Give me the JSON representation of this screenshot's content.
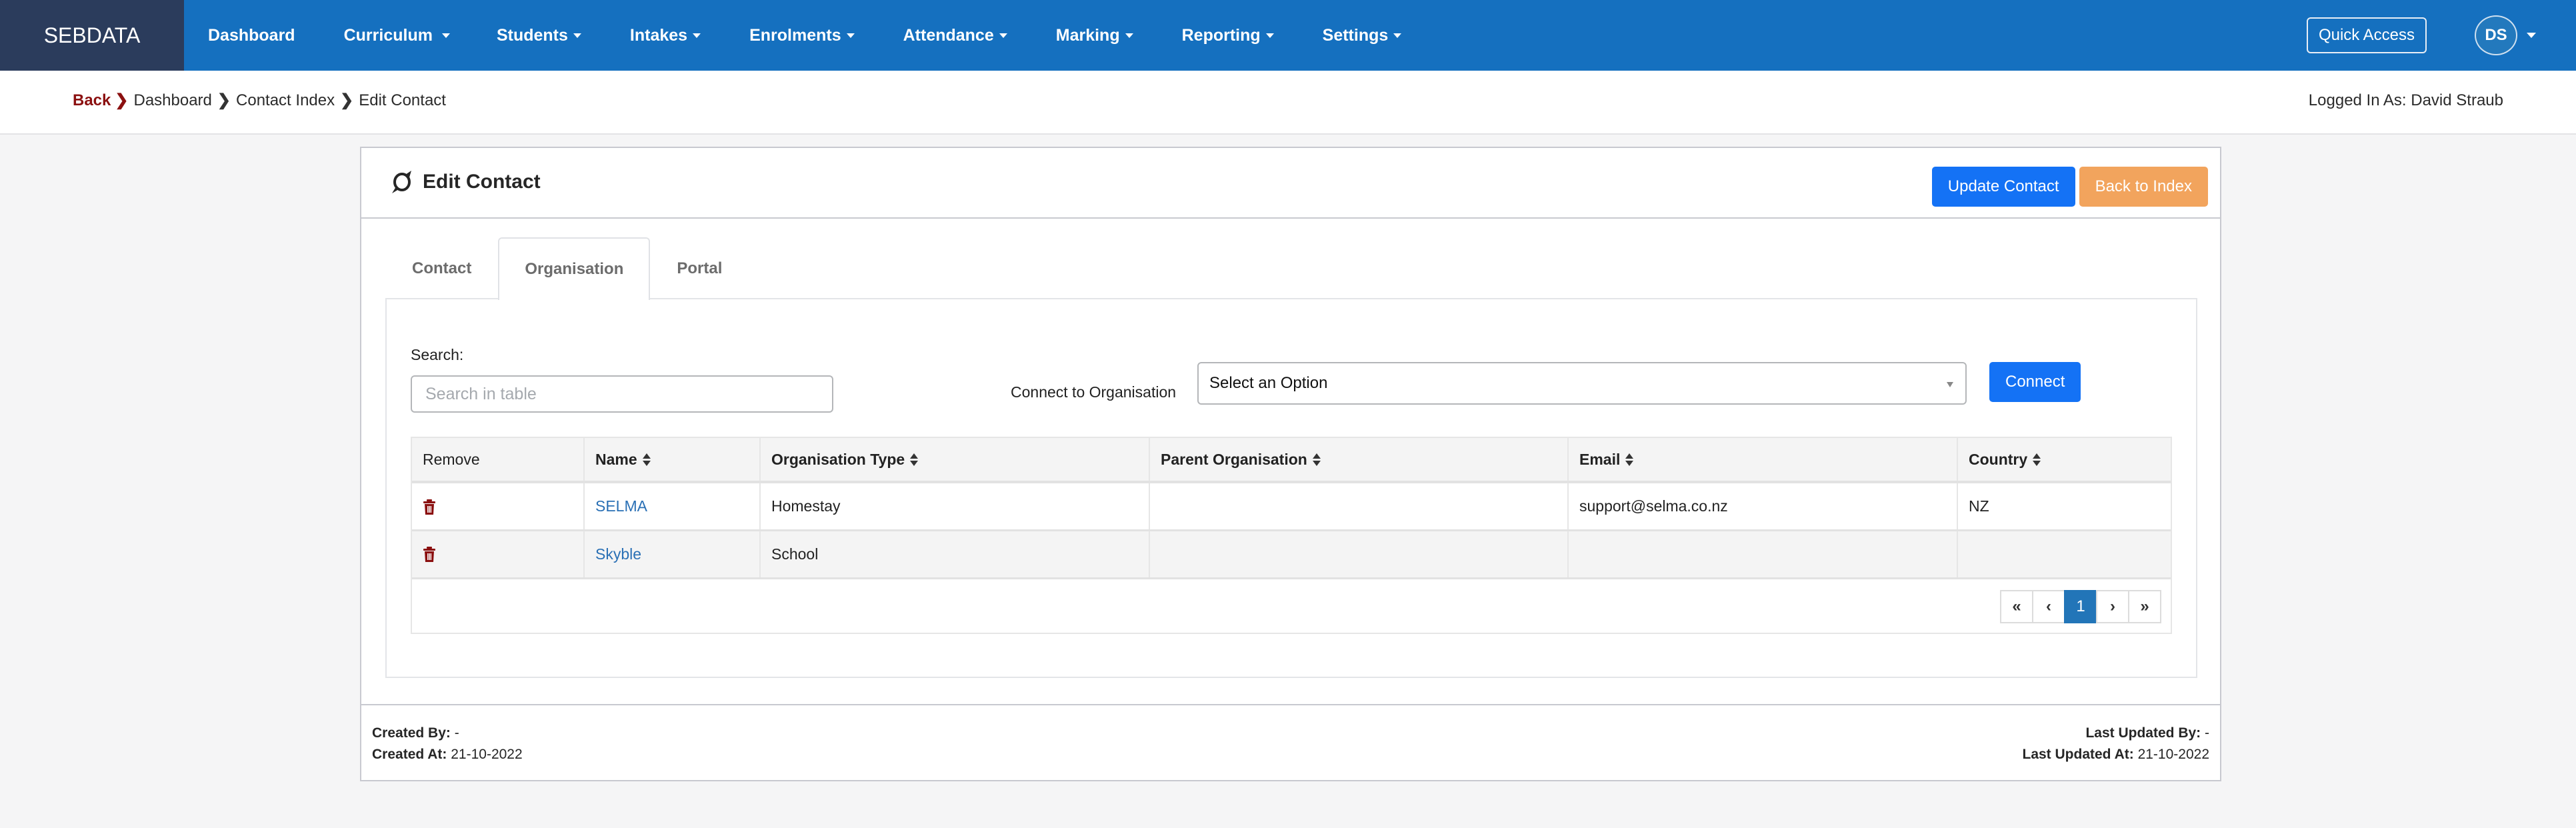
{
  "navbar": {
    "brand": "SEBDATA",
    "items": [
      {
        "label": "Dashboard",
        "dropdown": false
      },
      {
        "label": "Curriculum",
        "dropdown": true
      },
      {
        "label": "Students",
        "dropdown": true
      },
      {
        "label": "Intakes",
        "dropdown": true
      },
      {
        "label": "Enrolments",
        "dropdown": true
      },
      {
        "label": "Attendance",
        "dropdown": true
      },
      {
        "label": "Marking",
        "dropdown": true
      },
      {
        "label": "Reporting",
        "dropdown": true
      },
      {
        "label": "Settings",
        "dropdown": true
      }
    ],
    "quick_access": "Quick Access",
    "avatar_initials": "DS"
  },
  "breadcrumb": {
    "back": "Back",
    "items": [
      "Dashboard",
      "Contact Index",
      "Edit Contact"
    ]
  },
  "logged_in": "Logged In As: David Straub",
  "card": {
    "title": "Edit Contact",
    "update_button": "Update Contact",
    "back_button": "Back to Index",
    "tabs": [
      {
        "label": "Contact",
        "active": false
      },
      {
        "label": "Organisation",
        "active": true
      },
      {
        "label": "Portal",
        "active": false
      }
    ],
    "search": {
      "label": "Search:",
      "placeholder": "Search in table",
      "value": ""
    },
    "connect": {
      "label": "Connect to Organisation",
      "selected": "Select an Option",
      "button": "Connect"
    },
    "table": {
      "columns": [
        "Remove",
        "Name",
        "Organisation Type",
        "Parent Organisation",
        "Email",
        "Country"
      ],
      "rows": [
        {
          "name": "SELMA",
          "type": "Homestay",
          "parent": "",
          "email": "support@selma.co.nz",
          "country": "NZ"
        },
        {
          "name": "Skyble",
          "type": "School",
          "parent": "",
          "email": "",
          "country": ""
        }
      ]
    },
    "pagination": {
      "first": "«",
      "prev": "‹",
      "current": "1",
      "next": "›",
      "last": "»"
    },
    "footer": {
      "created_by_label": "Created By:",
      "created_by": "-",
      "created_at_label": "Created At:",
      "created_at": "21-10-2022",
      "updated_by_label": "Last Updated By:",
      "updated_by": "-",
      "updated_at_label": "Last Updated At:",
      "updated_at": "21-10-2022"
    }
  },
  "colors": {
    "navbar": "#1570bf",
    "brand_bg": "#2b3c5c",
    "primary": "#1472f5",
    "warning": "#f2a45d",
    "danger": "#8b1010",
    "link": "#2a70b5"
  }
}
